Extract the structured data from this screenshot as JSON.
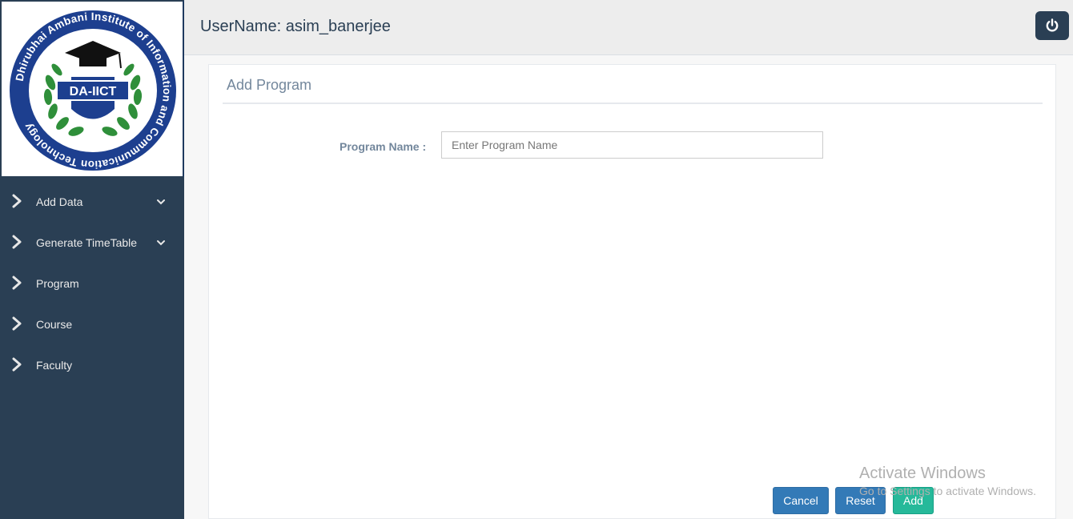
{
  "logo": {
    "seal_text": "Dhirubhai Ambani Institute of Information and Communication Technology",
    "badge_text": "DA-IICT"
  },
  "sidebar": {
    "items": [
      {
        "label": "Add Data",
        "has_submenu": true
      },
      {
        "label": "Generate TimeTable",
        "has_submenu": true
      },
      {
        "label": "Program",
        "has_submenu": false
      },
      {
        "label": "Course",
        "has_submenu": false
      },
      {
        "label": "Faculty",
        "has_submenu": false
      }
    ]
  },
  "header": {
    "username_text": "UserName: asim_banerjee",
    "logout_icon": "power-icon"
  },
  "panel": {
    "title": "Add Program"
  },
  "form": {
    "program_name_label": "Program Name :",
    "program_name_placeholder": "Enter Program Name",
    "program_name_value": ""
  },
  "actions": {
    "cancel_label": "Cancel",
    "reset_label": "Reset",
    "add_label": "Add"
  },
  "watermark": {
    "title": "Activate Windows",
    "subtitle": "Go to Settings to activate Windows."
  },
  "colors": {
    "sidebar_bg": "#2a3f54",
    "primary_button": "#337ab7",
    "success_button": "#26b99a",
    "seal_blue": "#1d3f8f"
  }
}
